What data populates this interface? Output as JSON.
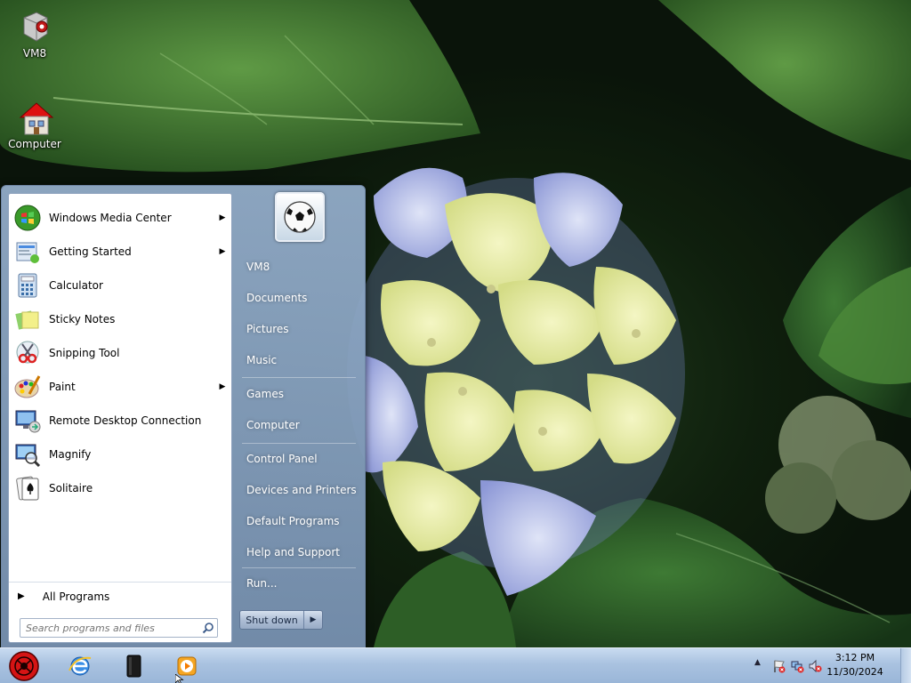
{
  "desktop": {
    "icons": [
      {
        "label": "VM8",
        "icon": "vm8-app-icon"
      },
      {
        "label": "Computer",
        "icon": "computer-house-icon"
      }
    ]
  },
  "start_menu": {
    "programs": [
      {
        "label": "Windows Media Center",
        "icon": "windows-media-center-icon",
        "has_submenu": true
      },
      {
        "label": "Getting Started",
        "icon": "getting-started-icon",
        "has_submenu": true
      },
      {
        "label": "Calculator",
        "icon": "calculator-icon",
        "has_submenu": false
      },
      {
        "label": "Sticky Notes",
        "icon": "sticky-notes-icon",
        "has_submenu": false
      },
      {
        "label": "Snipping Tool",
        "icon": "snipping-tool-icon",
        "has_submenu": false
      },
      {
        "label": "Paint",
        "icon": "paint-icon",
        "has_submenu": true
      },
      {
        "label": "Remote Desktop Connection",
        "icon": "remote-desktop-icon",
        "has_submenu": false
      },
      {
        "label": "Magnify",
        "icon": "magnify-icon",
        "has_submenu": false
      },
      {
        "label": "Solitaire",
        "icon": "solitaire-icon",
        "has_submenu": false
      }
    ],
    "all_programs_label": "All Programs",
    "search_placeholder": "Search programs and files",
    "places": [
      {
        "label": "VM8"
      },
      {
        "label": "Documents"
      },
      {
        "label": "Pictures"
      },
      {
        "label": "Music"
      },
      {
        "label": "Games"
      },
      {
        "label": "Computer"
      },
      {
        "label": "Control Panel"
      },
      {
        "label": "Devices and Printers"
      },
      {
        "label": "Default Programs"
      },
      {
        "label": "Help and Support"
      },
      {
        "label": "Run..."
      }
    ],
    "shutdown_label": "Shut down",
    "user_picture": "soccer-ball-icon"
  },
  "taskbar": {
    "pinned": [
      {
        "icon": "internet-explorer-icon"
      },
      {
        "icon": "vm-device-icon"
      },
      {
        "icon": "media-player-icon"
      }
    ],
    "tray_icons": [
      "show-hidden-icons-chevron",
      "action-center-flag-icon",
      "network-icon",
      "volume-muted-icon"
    ],
    "clock": {
      "time": "3:12 PM",
      "date": "11/30/2024"
    }
  },
  "colors": {
    "menu_frame": "#8ea6c4",
    "taskbar": "#a9c2e0",
    "start_orb": "#cc1010"
  }
}
